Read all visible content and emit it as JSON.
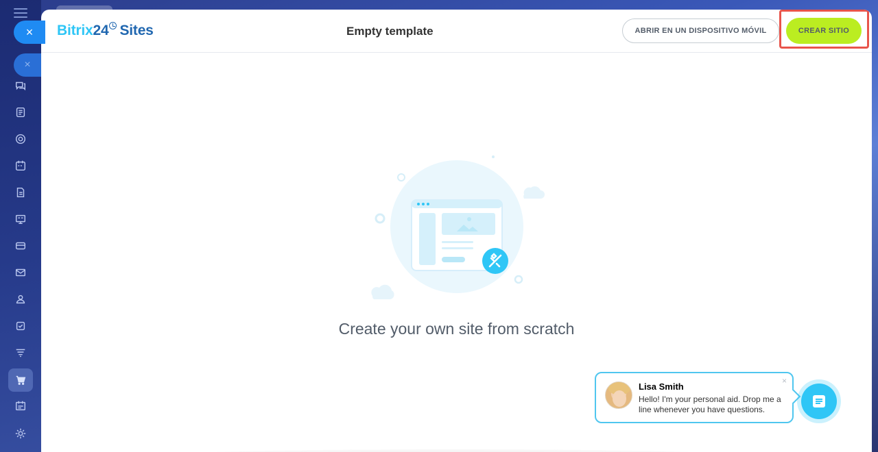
{
  "header": {
    "logo_part1": "Bitrix",
    "logo_part2": "24",
    "logo_part3": "Sites",
    "title": "Empty template",
    "mobile_button": "ABRIR EN UN DISPOSITIVO MÓVIL",
    "create_button": "CREAR SITIO"
  },
  "main": {
    "caption": "Create your own site from scratch"
  },
  "chat": {
    "name": "Lisa Smith",
    "message": "Hello! I'm your personal aid. Drop me a line whenever you have questions.",
    "close": "×"
  },
  "rail": {
    "close": "×",
    "icons": [
      "chat-icon",
      "feed-icon",
      "workflow-icon",
      "calendar-icon",
      "document-icon",
      "presentation-icon",
      "card-icon",
      "mail-icon",
      "contacts-icon",
      "tasks-icon",
      "filter-icon",
      "cart-icon",
      "schedule-icon",
      "settings-icon"
    ]
  },
  "colors": {
    "accent": "#2fc6f6",
    "create_button": "#bbed21",
    "highlight": "#e8544b"
  }
}
